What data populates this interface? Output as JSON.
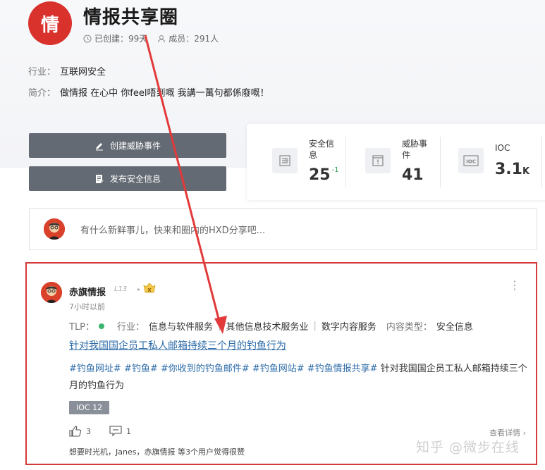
{
  "group": {
    "logo_char": "情",
    "title": "情报共享圈",
    "created": "已创建：99天",
    "members": "成员：291人",
    "industry_label": "行业：",
    "industry": "互联网安全",
    "intro_label": "简介：",
    "intro": "做情报 在心中 你feel唔到嘅 我講一萬句都係廢嘅！"
  },
  "actions": {
    "create_event": "创建威胁事件",
    "publish_info": "发布安全信息"
  },
  "stats": [
    {
      "label": "安全信息",
      "value": "25",
      "delta": "-1",
      "unit": "",
      "icon": "document-icon"
    },
    {
      "label": "威胁事件",
      "value": "41",
      "delta": "",
      "unit": "",
      "icon": "alert-window-icon"
    },
    {
      "label": "IOC",
      "value": "3.1",
      "delta": "",
      "unit": "K",
      "icon": "ioc-icon"
    }
  ],
  "composer": {
    "placeholder": "有什么新鲜事儿，快来和圈内的HXD分享吧..."
  },
  "post": {
    "author": "赤旗情报",
    "level": "L13",
    "badge_letter": "X",
    "time": "7小时以前",
    "tlp_label": "TLP：",
    "industry_label": "行业：",
    "industries": [
      "信息与软件服务",
      "其他信息技术服务业",
      "数字内容服务"
    ],
    "content_type_label": "内容类型：",
    "content_type": "安全信息",
    "title": "针对我国国企员工私人邮箱持续三个月的钓鱼行为",
    "tags": [
      "#钓鱼网址#",
      "#钓鱼#",
      "#你收到的钓鱼邮件#",
      "#钓鱼网站#",
      "#钓鱼情报共享#"
    ],
    "body_text": "针对我国国企员工私人邮箱持续三个月的钓鱼行为",
    "ioc_tag": "IOC 12",
    "like_count": "3",
    "comment_count": "1",
    "detail_link": "查看详情",
    "liked_by": "想要时光机，Janes，赤旗情报 等3个用户觉得很赞"
  },
  "watermark": "知乎 @微步在线",
  "colors": {
    "brand_red": "#d9312b",
    "button_gray": "#646a73",
    "link_blue": "#2c6ba8",
    "tlp_green": "#3db46d",
    "highlight_red": "#d63a3a"
  }
}
